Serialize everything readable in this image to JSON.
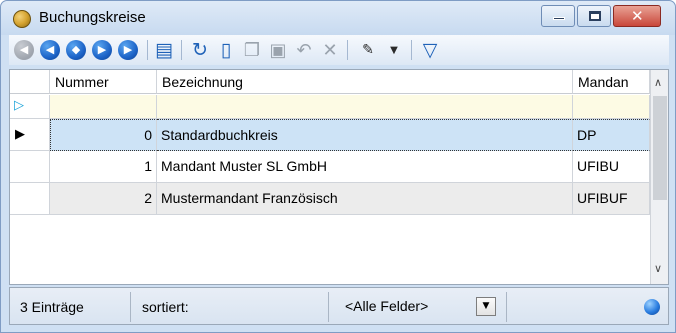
{
  "window": {
    "title": "Buchungskreise",
    "caption_close": "✕"
  },
  "toolbar": {
    "icons": [
      "first-record-icon",
      "previous-record-icon",
      "go-to-record-icon",
      "next-record-icon",
      "last-record-icon",
      "form-view-icon",
      "refresh-icon",
      "new-record-icon",
      "copy-record-icon",
      "save-icon",
      "undo-icon",
      "delete-icon",
      "tools-icon",
      "filter-icon"
    ]
  },
  "grid": {
    "columns": [
      "Nummer",
      "Bezeichnung",
      "Mandan"
    ],
    "rows": [
      {
        "nummer": "0",
        "bezeichnung": "Standardbuchkreis",
        "mandant": "DP"
      },
      {
        "nummer": "1",
        "bezeichnung": "Mandant Muster SL GmbH",
        "mandant": "UFIBU"
      },
      {
        "nummer": "2",
        "bezeichnung": "Mustermandant Französisch",
        "mandant": "UFIBUF"
      }
    ]
  },
  "status": {
    "count": "3 Einträge",
    "sort_label": "sortiert:",
    "field_filter": "<Alle Felder>"
  },
  "colors": {
    "selected_row": "#cde3f6",
    "new_row": "#fdfbe4",
    "accent": "#1f62b8"
  }
}
